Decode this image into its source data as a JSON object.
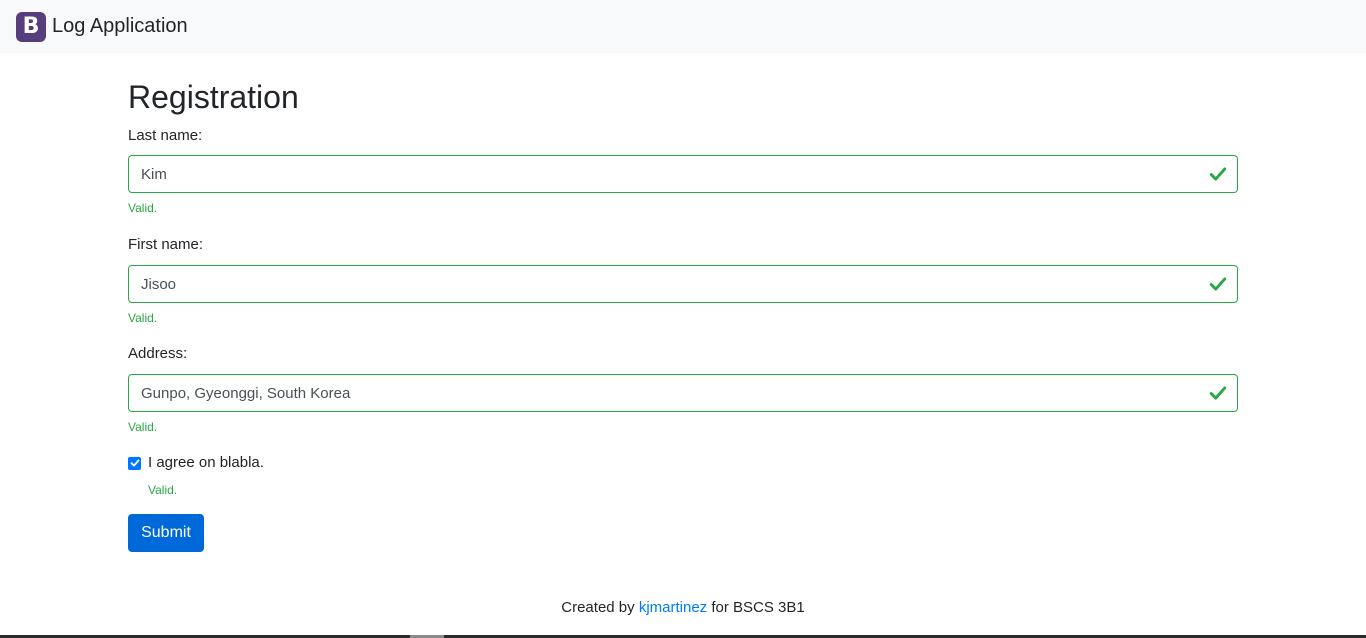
{
  "navbar": {
    "logo_letter": "B",
    "brand_color": "#563d7c",
    "title": "Log Application"
  },
  "form": {
    "title": "Registration",
    "fields": [
      {
        "label": "Last name:",
        "value": "Kim",
        "feedback": "Valid."
      },
      {
        "label": "First name:",
        "value": "Jisoo",
        "feedback": "Valid."
      },
      {
        "label": "Address:",
        "value": "Gunpo, Gyeonggi, South Korea",
        "feedback": "Valid."
      }
    ],
    "agreement": {
      "checked": true,
      "label": "I agree on blabla.",
      "feedback": "Valid."
    },
    "submit_label": "Submit",
    "valid_color": "#28a745",
    "button_color": "#0069d9"
  },
  "footer": {
    "prefix": "Created by",
    "author_link": "kjmartinez",
    "suffix": "for BSCS 3B1"
  }
}
